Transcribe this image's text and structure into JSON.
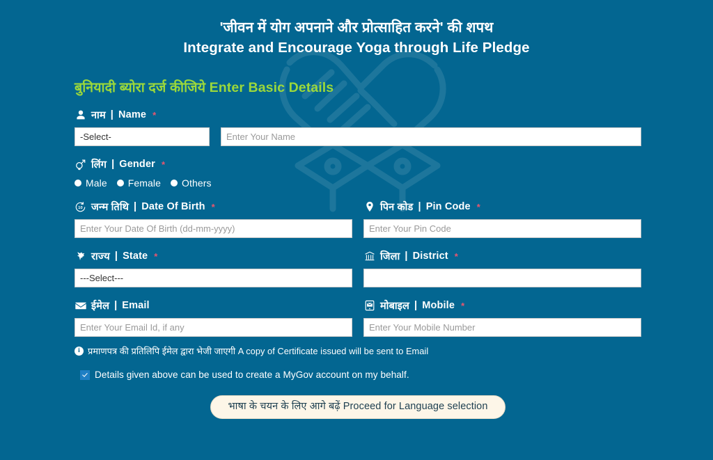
{
  "theme": {
    "background": "#036691",
    "heading_green": "#9bd83b",
    "label_white": "#ffffff",
    "required_red": "#e8566f",
    "input_bg": "#ffffff",
    "button_bg": "#fdf6e8",
    "button_text": "#1d3f50",
    "checkbox_blue": "#1f7fc4"
  },
  "header": {
    "title_hi": "'जीवन में योग अपनाने और प्रोत्साहित करने' की शपथ",
    "title_en": "Integrate and Encourage Yoga through Life Pledge"
  },
  "section": {
    "heading_hi": "बुनियादी ब्योरा दर्ज कीजिये",
    "heading_en": "Enter Basic Details"
  },
  "fields": {
    "name": {
      "icon": "person-icon",
      "label_hi": "नाम",
      "separator": "|",
      "label_en": "Name",
      "required": "*",
      "salutation_value": "-Select-",
      "name_placeholder": "Enter Your Name"
    },
    "gender": {
      "icon": "gender-icon",
      "label_hi": "लिंग",
      "separator": "|",
      "label_en": "Gender",
      "required": "*",
      "options": [
        {
          "label": "Male",
          "selected": false
        },
        {
          "label": "Female",
          "selected": false
        },
        {
          "label": "Others",
          "selected": false
        }
      ]
    },
    "dob": {
      "icon": "calendar-date-icon",
      "label_hi": "जन्म तिथि",
      "separator": "|",
      "label_en": "Date Of Birth",
      "required": "*",
      "placeholder": "Enter Your Date Of Birth (dd-mm-yyyy)",
      "value": ""
    },
    "pincode": {
      "icon": "map-pin-icon",
      "label_hi": "पिन कोड",
      "separator": "|",
      "label_en": "Pin Code",
      "required": "*",
      "placeholder": "Enter Your Pin Code",
      "value": ""
    },
    "state": {
      "icon": "india-map-icon",
      "label_hi": "राज्य",
      "separator": "|",
      "label_en": "State",
      "required": "*",
      "value": "---Select---"
    },
    "district": {
      "icon": "building-icon",
      "label_hi": "जिला",
      "separator": "|",
      "label_en": "District",
      "required": "*",
      "placeholder": "",
      "value": ""
    },
    "email": {
      "icon": "envelope-icon",
      "label_hi": "ईमेल",
      "separator": "|",
      "label_en": "Email",
      "required": "",
      "placeholder": "Enter Your Email Id, if any",
      "value": ""
    },
    "mobile": {
      "icon": "mobile-sms-icon",
      "label_hi": "मोबाइल",
      "separator": "|",
      "label_en": "Mobile",
      "required": "*",
      "placeholder": "Enter Your Mobile Number",
      "value": ""
    }
  },
  "note": {
    "icon": "info-icon",
    "text": "प्रमाणपत्र की प्रतिलिपि ईमेल द्वारा भेजी जाएगी A copy of Certificate issued will be sent to Email"
  },
  "consent": {
    "checked": true,
    "text": "Details given above can be used to create a MyGov account on my behalf."
  },
  "submit": {
    "label": "भाषा के चयन के लिए आगे बढ़ें Proceed for Language selection"
  }
}
